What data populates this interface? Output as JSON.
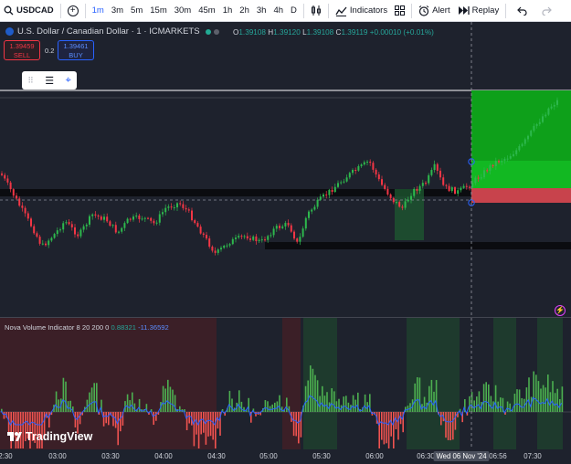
{
  "toolbar": {
    "symbol": "USDCAD",
    "add": "+",
    "timeframes": [
      "1m",
      "3m",
      "5m",
      "15m",
      "30m",
      "45m",
      "1h",
      "2h",
      "3h",
      "4h",
      "D"
    ],
    "active_timeframe": "1m",
    "indicators_label": "Indicators",
    "alert_label": "Alert",
    "replay_label": "Replay"
  },
  "header": {
    "title": "U.S. Dollar / Canadian Dollar · 1 · ICMARKETS",
    "ohlc": {
      "o_key": "O",
      "o": "1.39108",
      "h_key": "H",
      "h": "1.39120",
      "l_key": "L",
      "l": "1.39108",
      "c_key": "C",
      "c": "1.39119",
      "change": "+0.00010 (+0.01%)"
    }
  },
  "trade": {
    "sell_price": "1.39459",
    "sell_label": "SELL",
    "spread": "0.2",
    "buy_price": "1.39461",
    "buy_label": "BUY"
  },
  "indicator": {
    "name": "Nova Volume Indicator 8 20 200 0",
    "value1": "0.88321",
    "value2": "-11.36592"
  },
  "logo": {
    "text": "TradingView"
  },
  "time_axis": {
    "labels": [
      "2:30",
      "03:00",
      "03:30",
      "04:00",
      "04:30",
      "05:00",
      "05:30",
      "06:00",
      "06:30",
      "06:56",
      "07:30"
    ],
    "crosshair_label": "Wed 06 Nov '24"
  },
  "colors": {
    "up": "#26a69a",
    "up_candle": "#2db84d",
    "down": "#f23645",
    "background": "#1e222d",
    "accent": "#2962ff"
  },
  "icons": [
    "add-circle-icon",
    "candles-icon",
    "indicators-icon",
    "layout-icon",
    "alert-icon",
    "replay-icon",
    "undo-icon",
    "redo-icon",
    "lightning-icon"
  ]
}
